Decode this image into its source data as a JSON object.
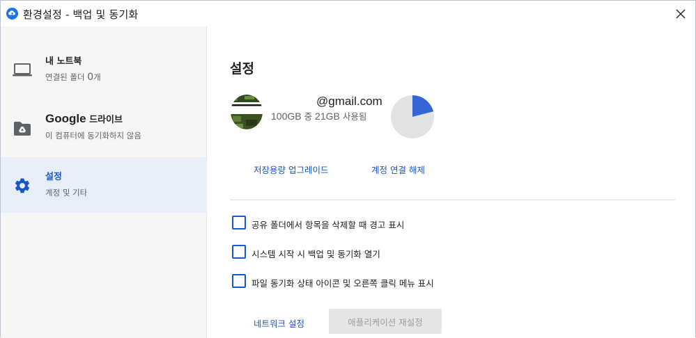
{
  "window": {
    "title": "환경설정 - 백업 및 동기화"
  },
  "sidebar": {
    "items": [
      {
        "title": "내 노트북",
        "subtitle_prefix": "연결된 폴더 ",
        "subtitle_count": "0",
        "subtitle_suffix": "개",
        "icon": "laptop-icon"
      },
      {
        "title_brand": "Google",
        "title_suffix": " 드라이브",
        "subtitle": "이 컴퓨터에 동기화하지 않음",
        "icon": "drive-folder-icon"
      },
      {
        "title": "설정",
        "subtitle": "계정 및 기타",
        "icon": "gear-icon",
        "active": true
      }
    ]
  },
  "main": {
    "section_title": "설정",
    "account": {
      "email": "@gmail.com",
      "usage_total": "100GB",
      "usage_mid": " 중 ",
      "usage_used": "21GB",
      "usage_suffix": " 사용됨",
      "used_fraction": 0.21
    },
    "links": {
      "upgrade": "저장용량 업그레이드",
      "disconnect": "계정 연결 해제",
      "network": "네트워크 설정"
    },
    "options": [
      {
        "label": "공유 폴더에서 항목을 삭제할 때 경고 표시",
        "checked": false
      },
      {
        "label": "시스템 시작 시 백업 및 동기화 열기",
        "checked": false
      },
      {
        "label": "파일 동기화 상태 아이콘 및 오른쪽 클릭 메뉴 표시",
        "checked": false
      }
    ],
    "reset_button": "애플리케이션 재설정"
  },
  "colors": {
    "accent": "#1a57c4",
    "pie_used": "#3367d6",
    "pie_free": "#e3e3e3",
    "sidebar_bg": "#f6f6f6",
    "active_bg": "#e8eef9"
  }
}
